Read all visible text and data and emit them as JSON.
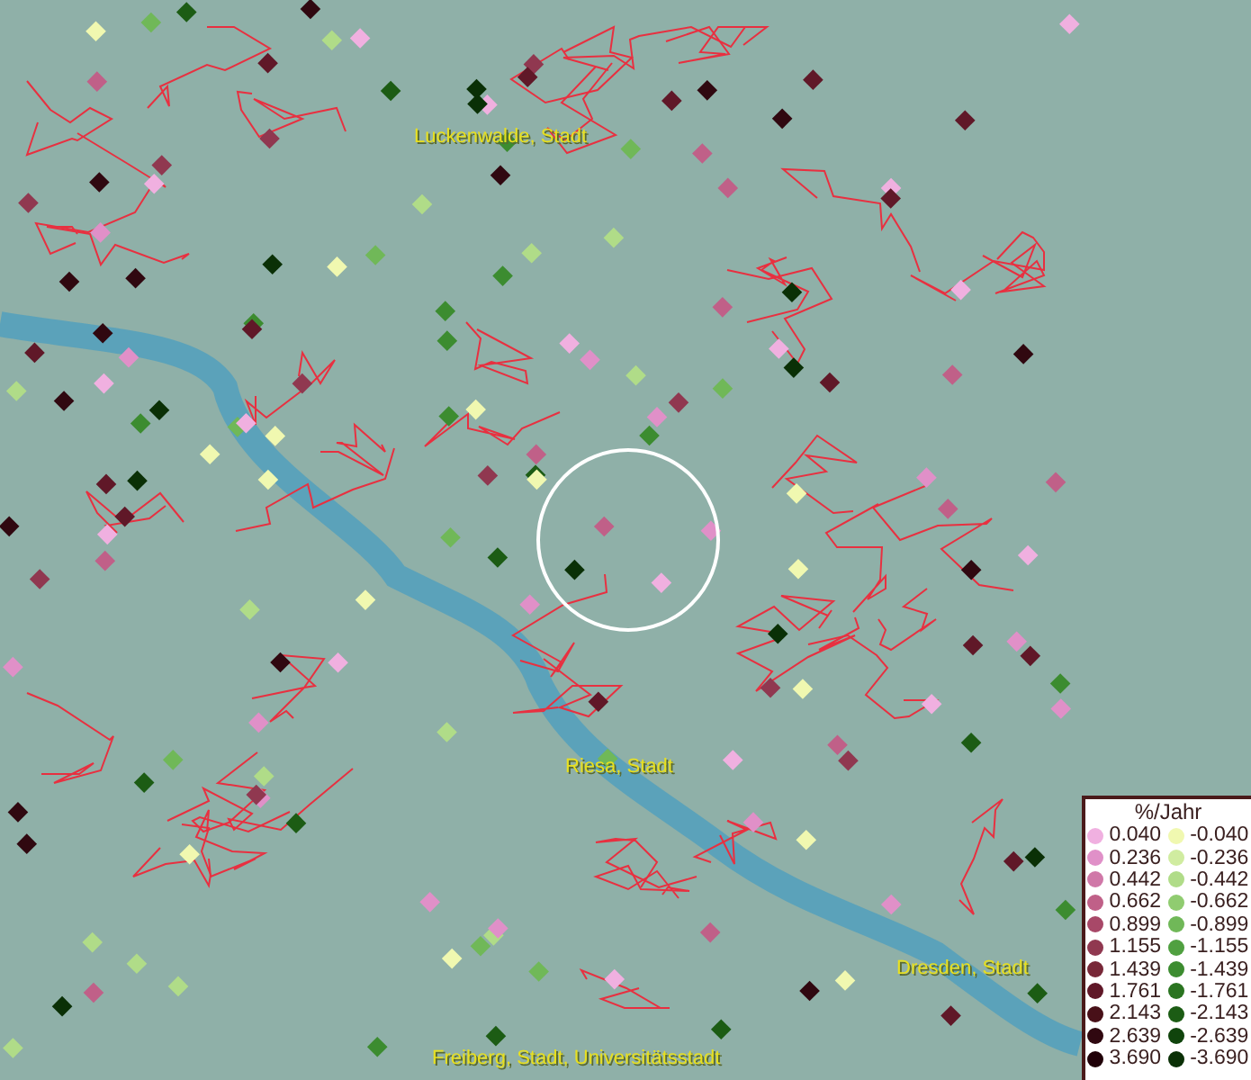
{
  "places": [
    {
      "name": "Luckenwalde, Stadt"
    },
    {
      "name": "Riesa, Stadt"
    },
    {
      "name": "Dresden, Stadt"
    },
    {
      "name": "Freiberg, Stadt, Universitätsstadt"
    }
  ],
  "legend": {
    "title": "%/Jahr",
    "positive": [
      {
        "label": "0.040",
        "color": "#f0b0e0"
      },
      {
        "label": "0.236",
        "color": "#e090c8"
      },
      {
        "label": "0.442",
        "color": "#d078a8"
      },
      {
        "label": "0.662",
        "color": "#c06088"
      },
      {
        "label": "0.899",
        "color": "#a84868"
      },
      {
        "label": "1.155",
        "color": "#903850"
      },
      {
        "label": "1.439",
        "color": "#782838"
      },
      {
        "label": "1.761",
        "color": "#601828"
      },
      {
        "label": "2.143",
        "color": "#481018"
      },
      {
        "label": "2.639",
        "color": "#300810"
      },
      {
        "label": "3.690",
        "color": "#200008"
      }
    ],
    "negative": [
      {
        "label": "-0.040",
        "color": "#f0f8b0"
      },
      {
        "label": "-0.236",
        "color": "#d0eca0"
      },
      {
        "label": "-0.442",
        "color": "#b0dc88"
      },
      {
        "label": "-0.662",
        "color": "#90cc70"
      },
      {
        "label": "-0.899",
        "color": "#70b858"
      },
      {
        "label": "-1.155",
        "color": "#50a040"
      },
      {
        "label": "-1.439",
        "color": "#3c8c30"
      },
      {
        "label": "-1.761",
        "color": "#2a7420"
      },
      {
        "label": "-2.143",
        "color": "#1c5c14"
      },
      {
        "label": "-2.639",
        "color": "#10440c"
      },
      {
        "label": "-3.690",
        "color": "#0a3006"
      }
    ]
  }
}
